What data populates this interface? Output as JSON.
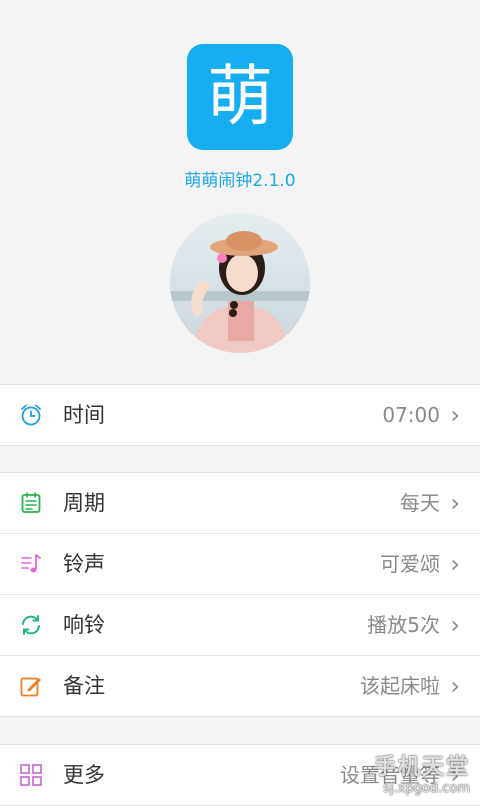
{
  "app": {
    "icon_char": "萌",
    "title": "萌萌闹钟2.1.0",
    "brand_color": "#16aef0"
  },
  "avatar": {
    "icon": "avatar-photo"
  },
  "settings": {
    "time": {
      "label": "时间",
      "value": "07:00",
      "icon": "alarm-clock-icon",
      "icon_color": "#1e9fdc"
    },
    "cycle": {
      "label": "周期",
      "value": "每天",
      "icon": "calendar-icon",
      "icon_color": "#27b34a"
    },
    "ringtone": {
      "label": "铃声",
      "value": "可爱颂",
      "icon": "music-note-icon",
      "icon_color": "#e36ad8"
    },
    "ring": {
      "label": "响铃",
      "value": "播放5次",
      "icon": "repeat-icon",
      "icon_color": "#1bb87a"
    },
    "note": {
      "label": "备注",
      "value": "该起床啦",
      "icon": "edit-icon",
      "icon_color": "#f07d22"
    },
    "more": {
      "label": "更多",
      "value": "设置音量等",
      "icon": "grid-icon",
      "icon_color": "#c76ed6"
    }
  },
  "chevron": "›",
  "watermark": {
    "title": "手机天堂",
    "url": "sj.xpgod.com"
  }
}
